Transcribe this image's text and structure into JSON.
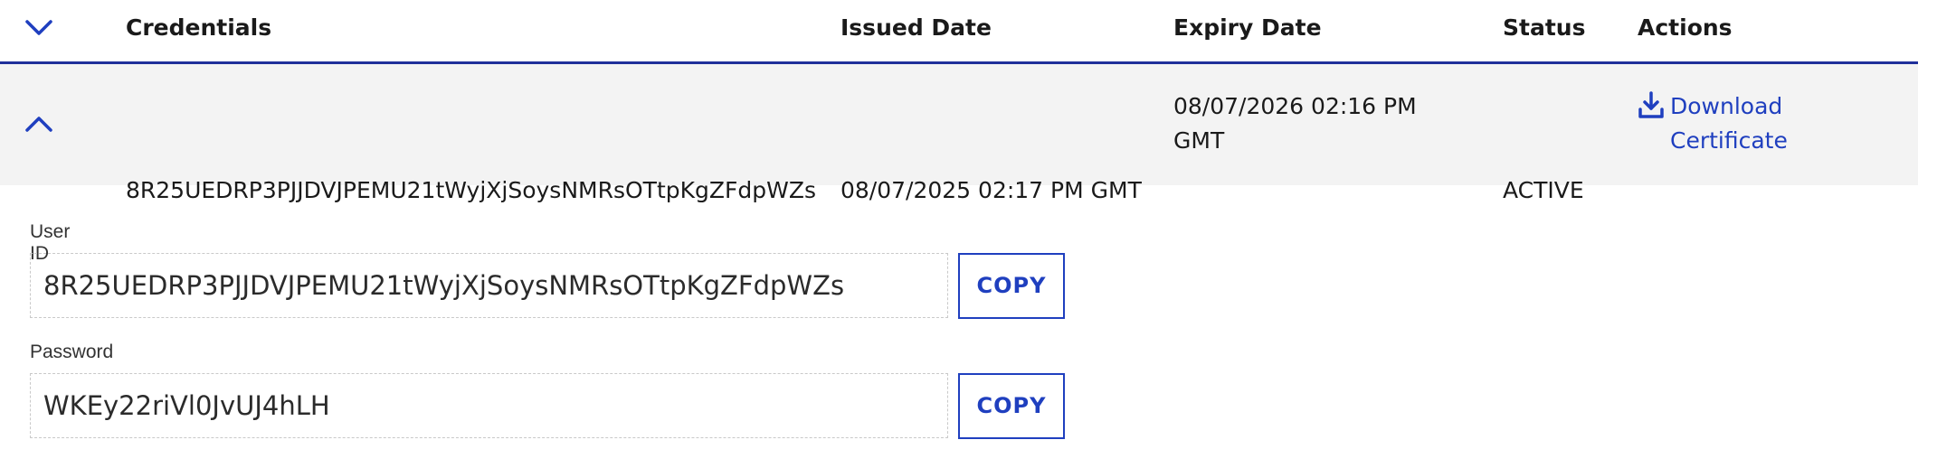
{
  "table": {
    "headers": {
      "credentials": "Credentials",
      "issued": "Issued Date",
      "expiry": "Expiry Date",
      "status": "Status",
      "actions": "Actions"
    },
    "row": {
      "credential": "8R25UEDRP3PJJDVJPEMU21tWyjXjSoysNMRsOTtpKgZFdpWZs",
      "issued": "08/07/2025 02:17 PM GMT",
      "expiry_line1": "08/07/2026 02:16 PM",
      "expiry_line2": "GMT",
      "status": "ACTIVE",
      "download_line1": "Download",
      "download_line2": "Certificate"
    }
  },
  "details": {
    "user_id_label": "User ID",
    "user_id_value": "8R25UEDRP3PJJDVJPEMU21tWyjXjSoysNMRsOTtpKgZFdpWZs",
    "password_label": "Password",
    "password_value": "WKEy22riVl0JvUJ4hLH",
    "copy_label": "COPY"
  },
  "icons": {
    "header_toggle": "chevron-down-icon",
    "row_toggle": "chevron-up-icon",
    "download": "download-icon"
  },
  "colors": {
    "accent": "#1f3fbf",
    "header_border": "#1f2f9a",
    "row_background": "#f3f3f3"
  }
}
